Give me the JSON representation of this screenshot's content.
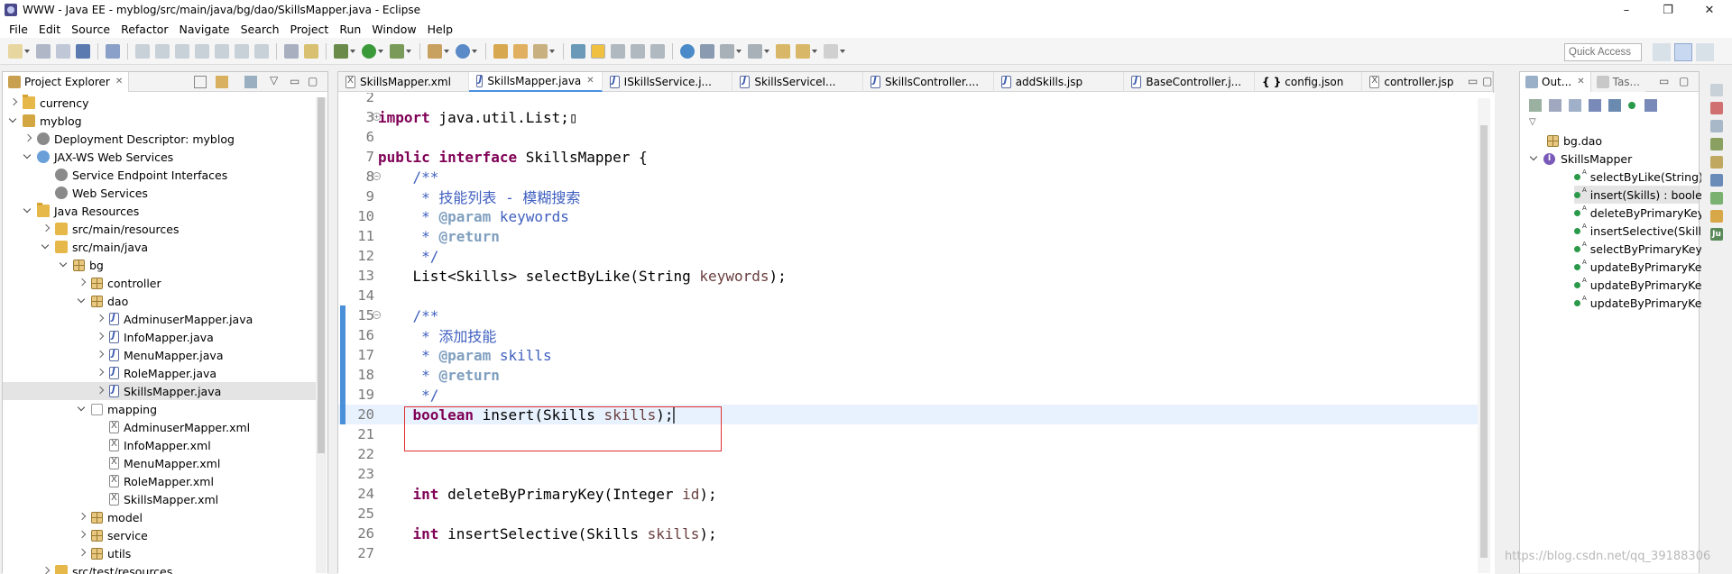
{
  "window": {
    "title": "WWW - Java EE - myblog/src/main/java/bg/dao/SkillsMapper.java - Eclipse",
    "minimize": "–",
    "maximize": "❐",
    "close": "✕"
  },
  "menu": [
    "File",
    "Edit",
    "Source",
    "Refactor",
    "Navigate",
    "Search",
    "Project",
    "Run",
    "Window",
    "Help"
  ],
  "toolbar": {
    "quick_access_placeholder": "Quick Access"
  },
  "explorer": {
    "tab_label": "Project Explorer",
    "items": [
      {
        "label": "currency",
        "level": 0,
        "arrow": "r",
        "icon": "folder"
      },
      {
        "label": "myblog",
        "level": 0,
        "arrow": "d",
        "icon": "project"
      },
      {
        "label": "Deployment Descriptor: myblog",
        "level": 1,
        "arrow": "r",
        "icon": "gear"
      },
      {
        "label": "JAX-WS Web Services",
        "level": 1,
        "arrow": "d",
        "icon": "globe"
      },
      {
        "label": "Service Endpoint Interfaces",
        "level": 2,
        "arrow": "n",
        "icon": "gear"
      },
      {
        "label": "Web Services",
        "level": 2,
        "arrow": "n",
        "icon": "gear"
      },
      {
        "label": "Java Resources",
        "level": 1,
        "arrow": "d",
        "icon": "folder"
      },
      {
        "label": "src/main/resources",
        "level": 2,
        "arrow": "r",
        "icon": "srcf"
      },
      {
        "label": "src/main/java",
        "level": 2,
        "arrow": "d",
        "icon": "srcf"
      },
      {
        "label": "bg",
        "level": 3,
        "arrow": "d",
        "icon": "pkg"
      },
      {
        "label": "controller",
        "level": 4,
        "arrow": "r",
        "icon": "pkg"
      },
      {
        "label": "dao",
        "level": 4,
        "arrow": "d",
        "icon": "pkg"
      },
      {
        "label": "AdminuserMapper.java",
        "level": 5,
        "arrow": "r",
        "icon": "jfile"
      },
      {
        "label": "InfoMapper.java",
        "level": 5,
        "arrow": "r",
        "icon": "jfile"
      },
      {
        "label": "MenuMapper.java",
        "level": 5,
        "arrow": "r",
        "icon": "jfile"
      },
      {
        "label": "RoleMapper.java",
        "level": 5,
        "arrow": "r",
        "icon": "jfile"
      },
      {
        "label": "SkillsMapper.java",
        "level": 5,
        "arrow": "r",
        "icon": "jfile",
        "selected": true
      },
      {
        "label": "mapping",
        "level": 4,
        "arrow": "d",
        "icon": "pkgw"
      },
      {
        "label": "AdminuserMapper.xml",
        "level": 5,
        "arrow": "n",
        "icon": "xfile"
      },
      {
        "label": "InfoMapper.xml",
        "level": 5,
        "arrow": "n",
        "icon": "xfile"
      },
      {
        "label": "MenuMapper.xml",
        "level": 5,
        "arrow": "n",
        "icon": "xfile"
      },
      {
        "label": "RoleMapper.xml",
        "level": 5,
        "arrow": "n",
        "icon": "xfile"
      },
      {
        "label": "SkillsMapper.xml",
        "level": 5,
        "arrow": "n",
        "icon": "xfile"
      },
      {
        "label": "model",
        "level": 4,
        "arrow": "r",
        "icon": "pkg"
      },
      {
        "label": "service",
        "level": 4,
        "arrow": "r",
        "icon": "pkg"
      },
      {
        "label": "utils",
        "level": 4,
        "arrow": "r",
        "icon": "pkg"
      },
      {
        "label": "src/test/resources",
        "level": 2,
        "arrow": "r",
        "icon": "srcf"
      }
    ]
  },
  "editor": {
    "tabs": [
      {
        "label": "SkillsMapper.xml",
        "active": false
      },
      {
        "label": "SkillsMapper.java",
        "active": true
      },
      {
        "label": "ISkillsService.j...",
        "active": false
      },
      {
        "label": "SkillsServiceI...",
        "active": false
      },
      {
        "label": "SkillsController....",
        "active": false
      },
      {
        "label": "addSkills.jsp",
        "active": false
      },
      {
        "label": "BaseController.j...",
        "active": false
      },
      {
        "label": "config.json",
        "active": false
      },
      {
        "label": "controller.jsp",
        "active": false
      }
    ],
    "lines": [
      {
        "num": "2",
        "html": ""
      },
      {
        "num": "3",
        "html": "<span class=\"kw\">import</span> java.util.List;▯",
        "fold": true
      },
      {
        "num": "6",
        "html": ""
      },
      {
        "num": "7",
        "html": "<span class=\"kw\">public</span> <span class=\"kw\">interface</span> SkillsMapper {"
      },
      {
        "num": "8",
        "html": "    <span class=\"cm\">/**</span>",
        "fold": true
      },
      {
        "num": "9",
        "html": "<span class=\"cm\">     * 技能列表 - 模糊搜索</span>"
      },
      {
        "num": "10",
        "html": "<span class=\"cm\">     * </span><span class=\"cmk\">@param</span><span class=\"cm\"> keywords</span>"
      },
      {
        "num": "11",
        "html": "<span class=\"cm\">     * </span><span class=\"cmk\">@return</span>"
      },
      {
        "num": "12",
        "html": "<span class=\"cm\">     */</span>"
      },
      {
        "num": "13",
        "html": "    List&lt;Skills&gt; selectByLike(String <span class=\"param\">keywords</span>);"
      },
      {
        "num": "14",
        "html": ""
      },
      {
        "num": "15",
        "html": "    <span class=\"cm\">/**</span>",
        "fold": true,
        "changed": true
      },
      {
        "num": "16",
        "html": "<span class=\"cm\">     * 添加技能</span>",
        "changed": true
      },
      {
        "num": "17",
        "html": "<span class=\"cm\">     * </span><span class=\"cmk\">@param</span><span class=\"cm\"> skills</span>",
        "changed": true
      },
      {
        "num": "18",
        "html": "<span class=\"cm\">     * </span><span class=\"cmk\">@return</span>",
        "changed": true
      },
      {
        "num": "19",
        "html": "<span class=\"cm\">     */</span>",
        "changed": true
      },
      {
        "num": "20",
        "html": "    <span class=\"kw\">boolean</span> insert(Skills <span class=\"param\">skills</span>);▏",
        "changed": true,
        "current": true
      },
      {
        "num": "21",
        "html": ""
      },
      {
        "num": "22",
        "html": ""
      },
      {
        "num": "23",
        "html": ""
      },
      {
        "num": "24",
        "html": "    <span class=\"kw\">int</span> deleteByPrimaryKey(Integer <span class=\"param\">id</span>);"
      },
      {
        "num": "25",
        "html": ""
      },
      {
        "num": "26",
        "html": "    <span class=\"kw\">int</span> insertSelective(Skills <span class=\"param\">skills</span>);"
      },
      {
        "num": "27",
        "html": ""
      }
    ]
  },
  "outline": {
    "tab_label": "Out...",
    "tab2_label": "Tas...",
    "package": "bg.dao",
    "interface": "SkillsMapper",
    "interface_icon": "I",
    "methods": [
      {
        "label": "selectByLike(String)",
        "selected": false
      },
      {
        "label": "insert(Skills) : boole",
        "selected": true
      },
      {
        "label": "deleteByPrimaryKey",
        "selected": false
      },
      {
        "label": "insertSelective(Skills",
        "selected": false
      },
      {
        "label": "selectByPrimaryKey(",
        "selected": false
      },
      {
        "label": "updateByPrimaryKe",
        "selected": false
      },
      {
        "label": "updateByPrimaryKe",
        "selected": false
      },
      {
        "label": "updateByPrimaryKe",
        "selected": false
      }
    ]
  },
  "watermark": "https://blog.csdn.net/qq_39188306",
  "colors": {
    "keyword": "#7f0055",
    "comment": "#3f5fbf",
    "javadoc_tag": "#7f9fbf",
    "parameter": "#6a3e3e",
    "highlight_box": "#e03030",
    "current_line": "#e8f2fe"
  }
}
